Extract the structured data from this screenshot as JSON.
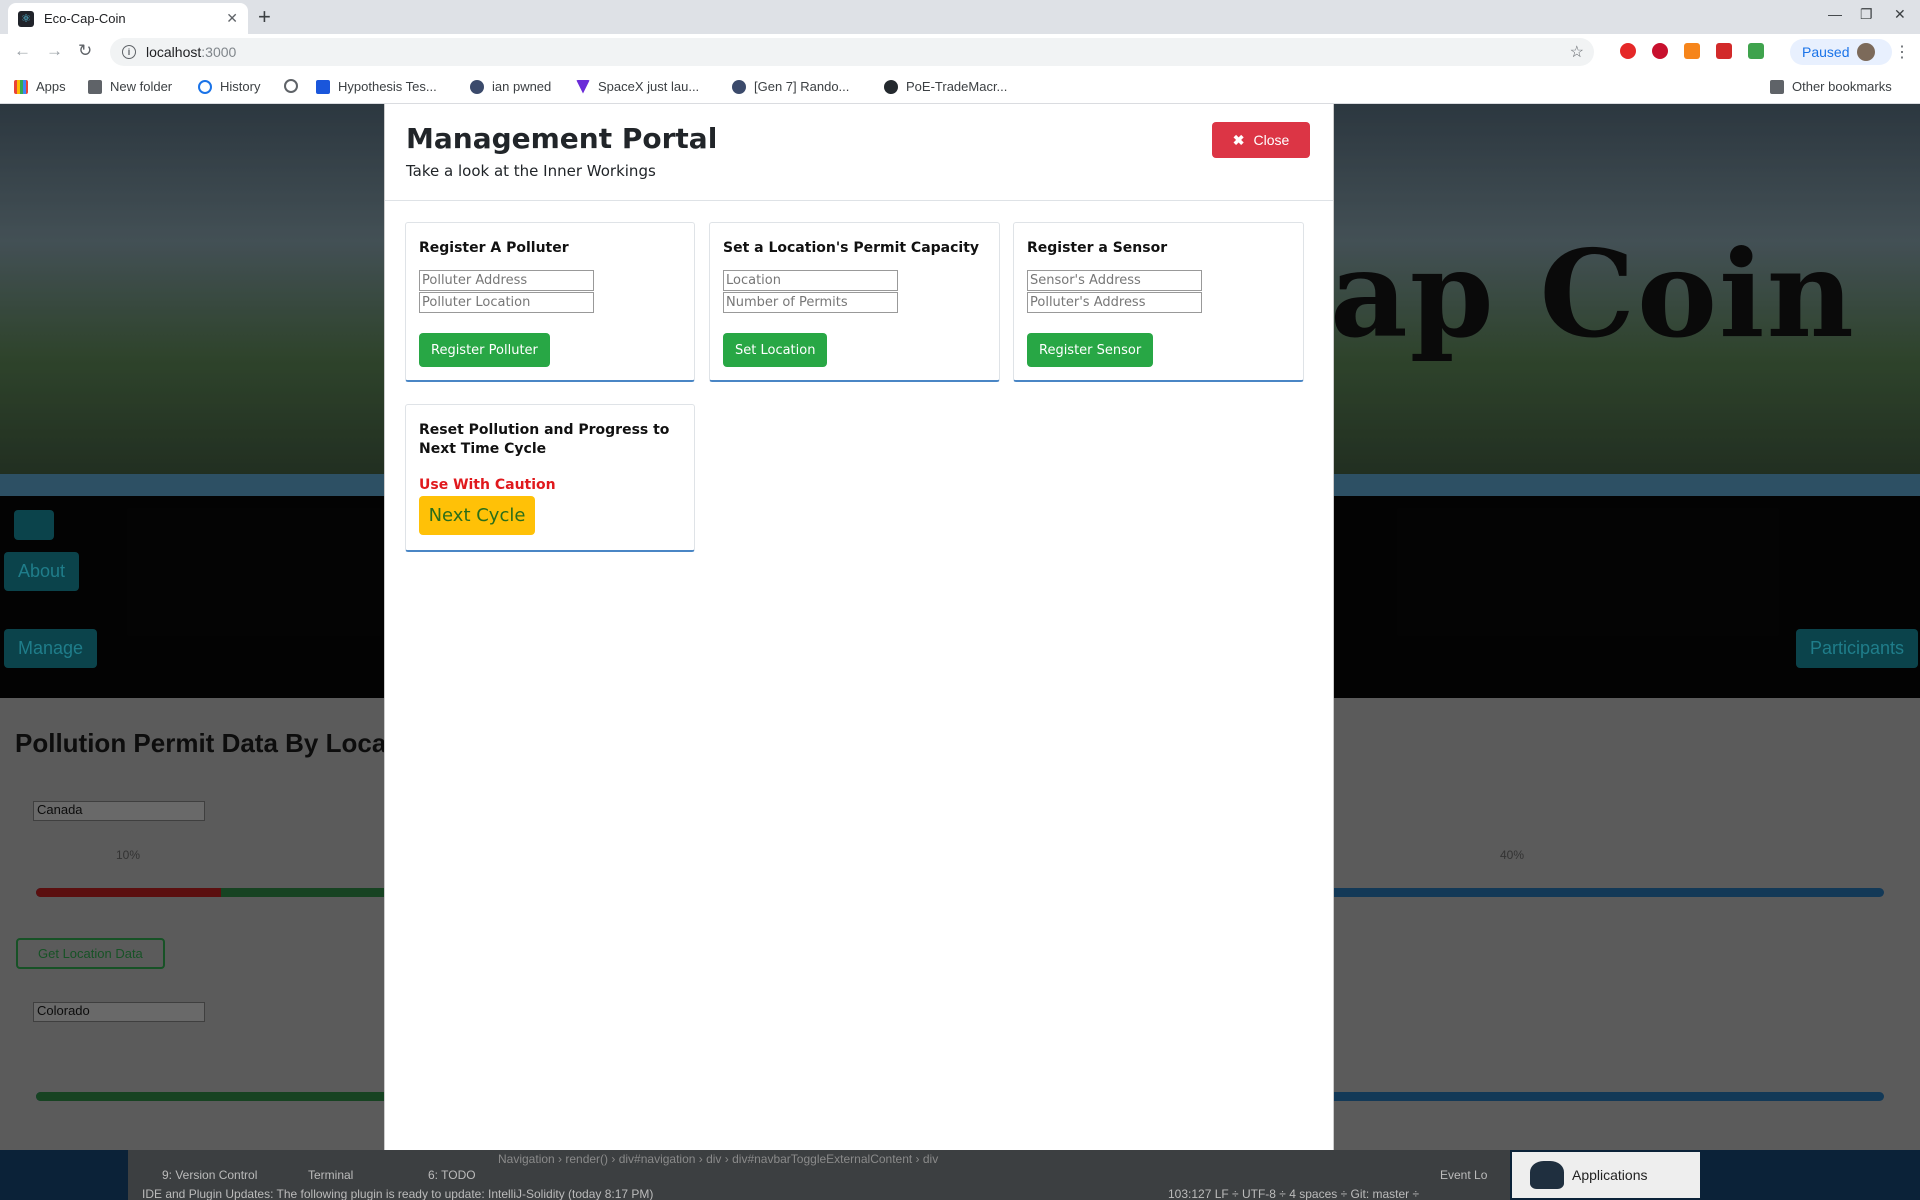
{
  "browser": {
    "tab_title": "Eco-Cap-Coin",
    "new_tab": "+",
    "url_host": "localhost",
    "url_port": ":3000",
    "profile_status": "Paused",
    "bookmarks": [
      "Apps",
      "New folder",
      "History",
      "",
      "Hypothesis Tes...",
      "ian pwned",
      "SpaceX just lau...",
      "[Gen 7] Rando...",
      "PoE-TradeMacr..."
    ],
    "other_bookmarks": "Other bookmarks"
  },
  "background_page": {
    "hero_title": "ap Coin",
    "nav_about": "About",
    "nav_manage": "Manage",
    "nav_participants": "Participants",
    "section_title": "Pollution Permit Data By Loca",
    "location_1": "Canada",
    "location_2": "Colorado",
    "tick_10": "10%",
    "tick_40": "40%",
    "progress_red_fraction": 0.1,
    "get_location_button": "Get Location Data"
  },
  "modal": {
    "title": "Management Portal",
    "subtitle": "Take a look at the Inner Workings",
    "close_label": "Close",
    "cards": {
      "polluter": {
        "title": "Register A Polluter",
        "placeholder_address": "Polluter Address",
        "placeholder_location": "Polluter Location",
        "button": "Register Polluter"
      },
      "permit": {
        "title": "Set a Location's Permit Capacity",
        "placeholder_location": "Location",
        "placeholder_permits": "Number of Permits",
        "button": "Set Location"
      },
      "sensor": {
        "title": "Register a Sensor",
        "placeholder_sensor": "Sensor's Address",
        "placeholder_polluter": "Polluter's Address",
        "button": "Register Sensor"
      },
      "reset": {
        "title": "Reset Pollution and Progress to Next Time Cycle",
        "caution": "Use With Caution",
        "button": "Next Cycle"
      }
    }
  },
  "ide": {
    "version_control": "9: Version Control",
    "terminal": "Terminal",
    "todo": "6: TODO",
    "breadcrumb": "Navigation  ›  render()  ›  div#navigation  ›  div  ›  div#navbarToggleExternalContent  ›  div",
    "notice": "IDE and Plugin Updates: The following plugin is ready to update: IntelliJ-Solidity (today 8:17 PM)",
    "status": "103:127   LF ÷   UTF-8 ÷   4 spaces ÷   Git: master ÷",
    "event_log": "Event Lo",
    "applications": "Applications"
  },
  "colors": {
    "danger": "#dc3545",
    "success": "#28a745",
    "warning": "#ffc107",
    "caution_text": "#e0191d"
  }
}
